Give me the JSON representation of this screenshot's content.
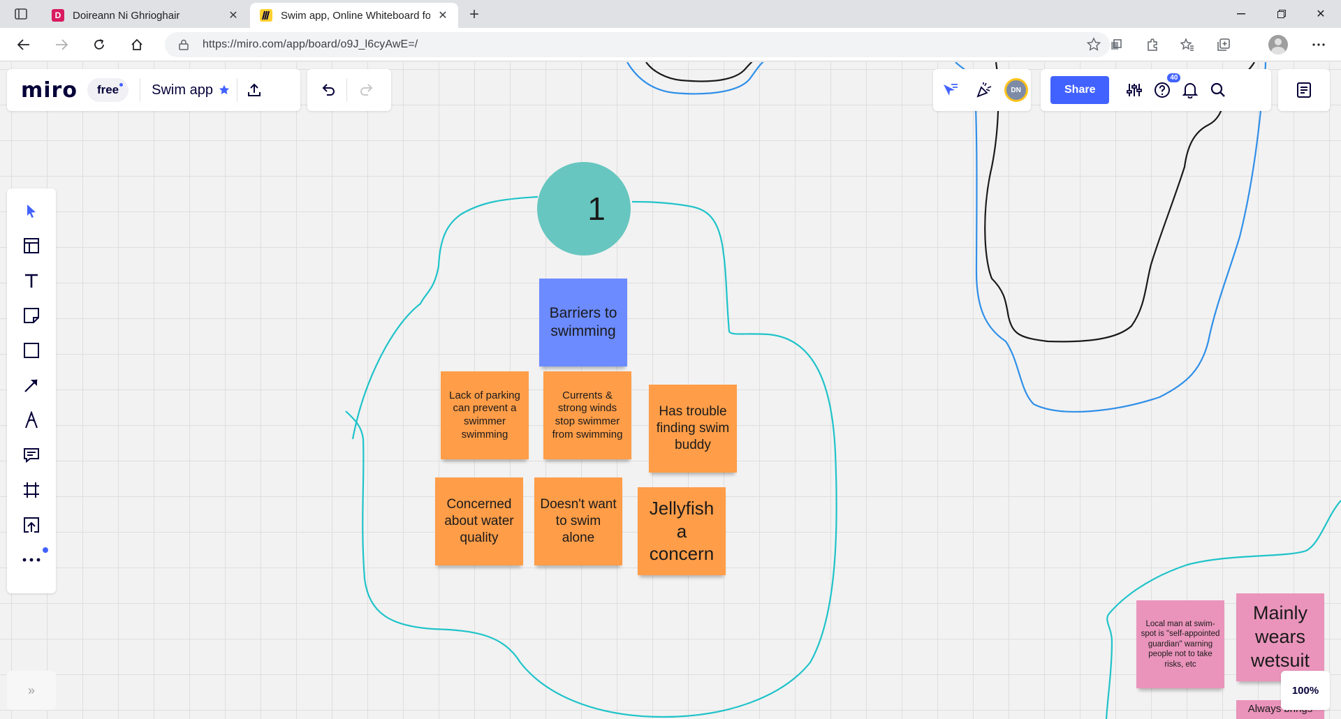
{
  "browser": {
    "tabs": [
      {
        "favicon": "D",
        "title": "Doireann Ni Ghrioghair"
      },
      {
        "favicon": "M",
        "title": "Swim app, Online Whiteboard fo"
      }
    ],
    "url": "https://miro.com/app/board/o9J_l6cyAwE=/"
  },
  "miro": {
    "logo": "miro",
    "plan": "free",
    "board_name": "Swim app",
    "share_label": "Share",
    "avatar_initials": "DN",
    "help_badge": "40",
    "zoom": "100%"
  },
  "board": {
    "circle_label": "1",
    "notes": {
      "barriers": "Barriers to swimming",
      "parking": "Lack of parking can prevent a swimmer swimming",
      "currents": "Currents & strong winds stop swimmer from swimming",
      "buddy": "Has trouble finding swim buddy",
      "water": "Concerned about water quality",
      "alone": "Doesn't want to swim alone",
      "jellyfish": "Jellyfish a concern",
      "guardian": "Local man at swim-spot is \"self-appointed guardian\" warning people not to take risks, etc",
      "wetsuit": "Mainly wears wetsuit",
      "brings": "Always brings"
    }
  },
  "colors": {
    "accent": "#4262ff",
    "sticky_orange": "#ff9d48",
    "sticky_blue": "#6c8bff",
    "sticky_pink": "#ea94bb",
    "circle_teal": "#67c6c0",
    "stroke_teal": "#1fc3c9",
    "stroke_blue": "#2f8fe8"
  }
}
